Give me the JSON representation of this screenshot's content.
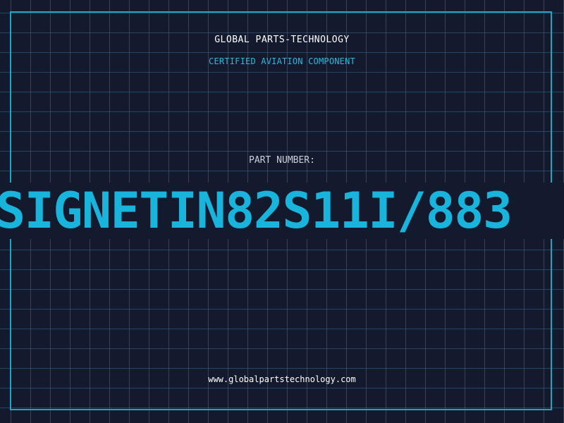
{
  "header": {
    "company_name": "GLOBAL PARTS-TECHNOLOGY",
    "tagline": "CERTIFIED AVIATION COMPONENT"
  },
  "part": {
    "label": "PART NUMBER:",
    "number": "SIGNETIN82S11I/883"
  },
  "footer": {
    "website": "www.globalpartstechnology.com"
  },
  "colors": {
    "background": "#131a2e",
    "grid": "#286e8c",
    "accent": "#18b4dc",
    "frame": "#1fa3c6"
  }
}
